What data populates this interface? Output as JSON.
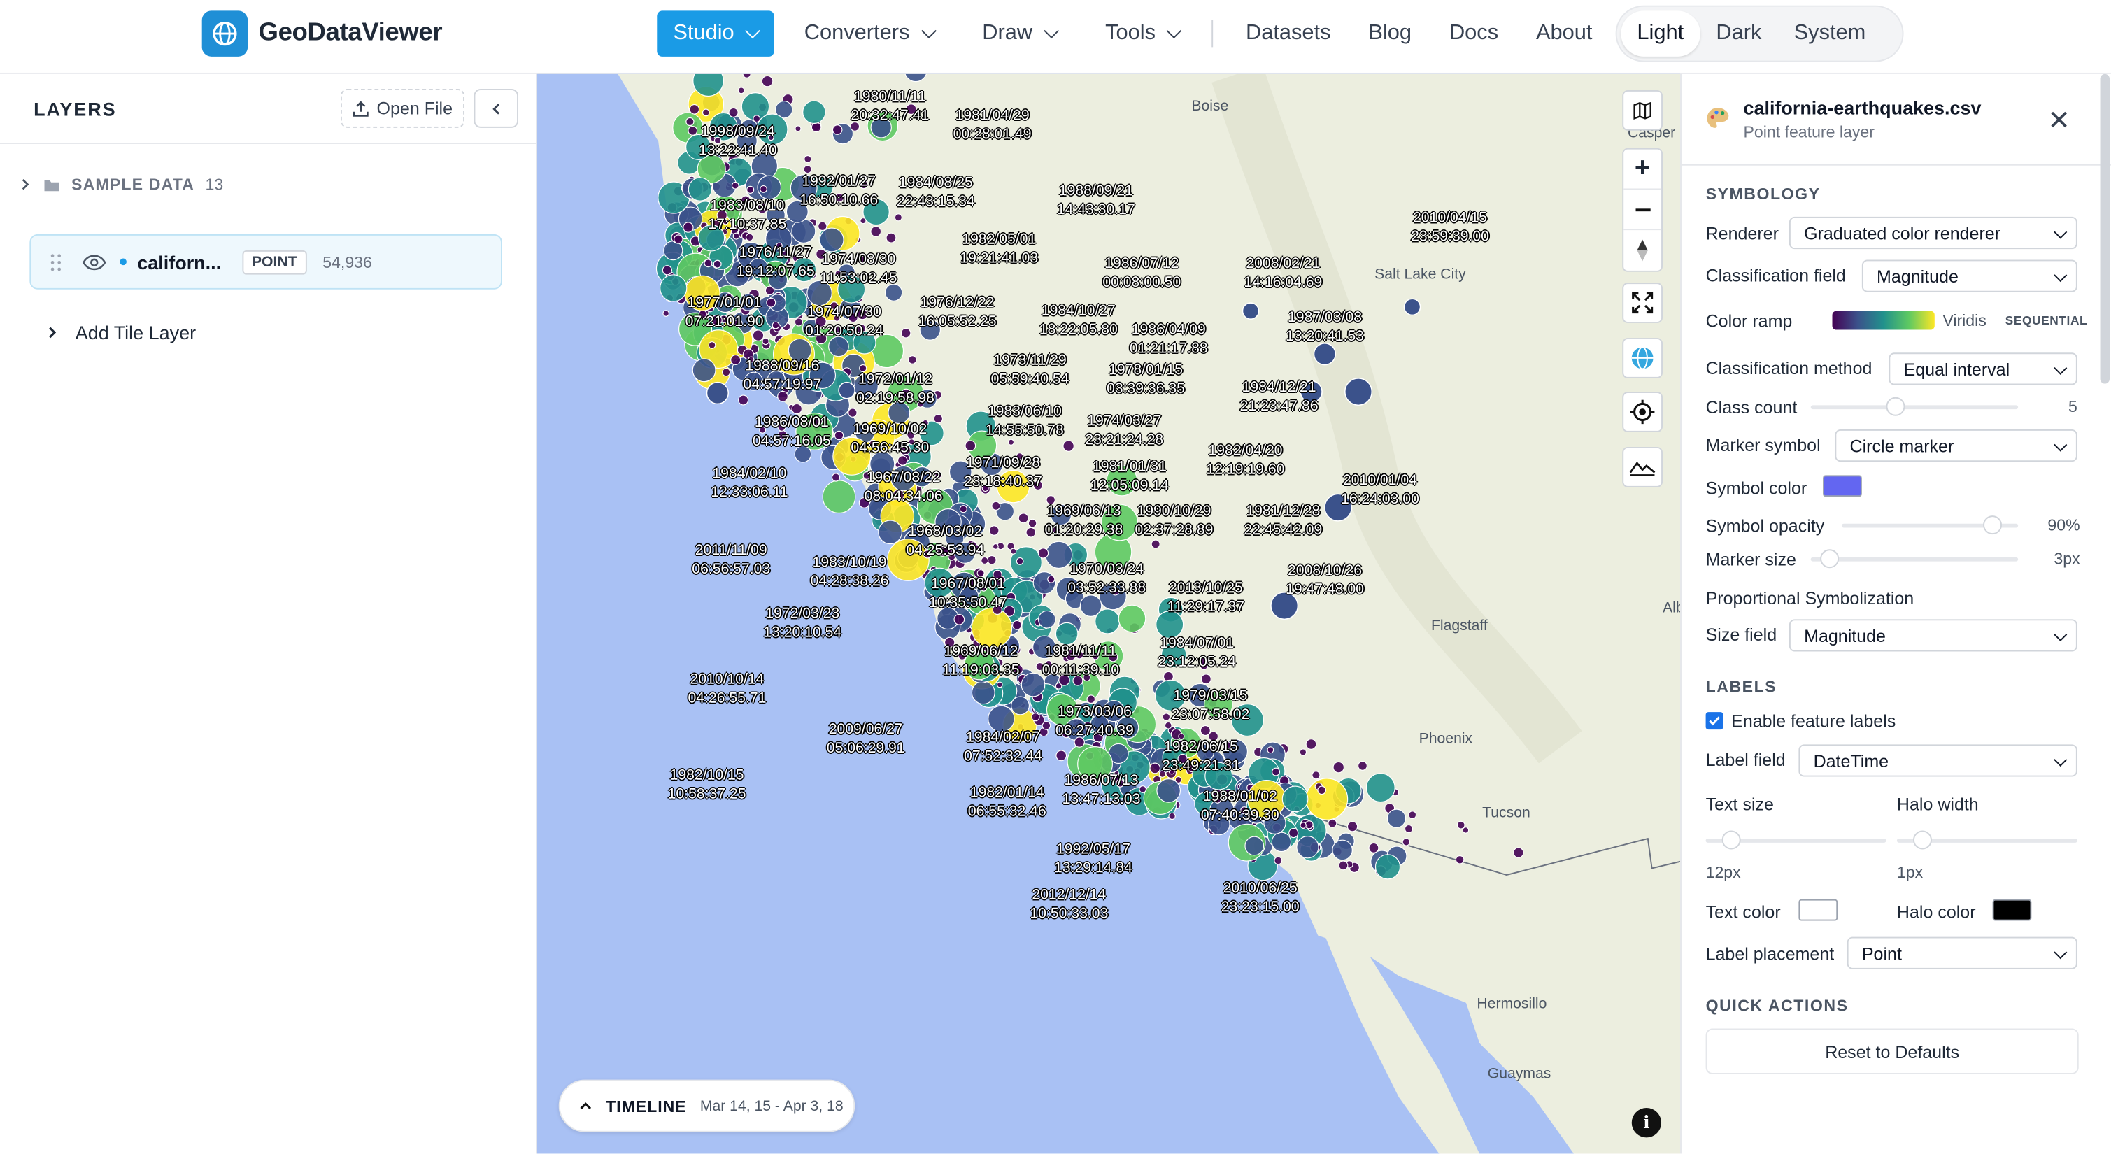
{
  "app": {
    "name": "GeoDataViewer"
  },
  "nav": {
    "items": [
      {
        "label": "Studio",
        "has_dropdown": true,
        "active": true
      },
      {
        "label": "Converters",
        "has_dropdown": true
      },
      {
        "label": "Draw",
        "has_dropdown": true
      },
      {
        "label": "Tools",
        "has_dropdown": true
      },
      {
        "label": "Datasets"
      },
      {
        "label": "Blog"
      },
      {
        "label": "Docs"
      },
      {
        "label": "About"
      }
    ],
    "theme_options": [
      "Light",
      "Dark",
      "System"
    ],
    "theme_selected": "Light"
  },
  "layers_panel": {
    "title": "LAYERS",
    "open_file_label": "Open File",
    "group": {
      "title": "SAMPLE DATA",
      "count": "13"
    },
    "layer": {
      "name": "californ...",
      "type_badge": "POINT",
      "feature_count": "54,936"
    },
    "add_tile_label": "Add Tile Layer"
  },
  "map": {
    "place_labels": [
      "Boise",
      "Casper",
      "Salt Lake City",
      "Flagstaff",
      "Phoenix",
      "Tucson",
      "Hermosillo",
      "Guaymas",
      "Alb"
    ],
    "feature_labels": [
      {
        "date": "1980/11/11",
        "time": "20:32:47.41"
      },
      {
        "date": "1981/04/29",
        "time": "00:28:01.49"
      },
      {
        "date": "1998/09/24",
        "time": "13:22:41.40"
      },
      {
        "date": "1992/01/27",
        "time": "16:50:10.66"
      },
      {
        "date": "1984/08/25",
        "time": "22:43:15.34"
      },
      {
        "date": "1988/09/21",
        "time": "14:43:30.17"
      },
      {
        "date": "1983/08/10",
        "time": "17:10:37.85"
      },
      {
        "date": "1982/05/01",
        "time": "19:21:41.03"
      },
      {
        "date": "1976/11/27",
        "time": "19:12:07.65"
      },
      {
        "date": "1974/08/30",
        "time": "11:53:02.45"
      },
      {
        "date": "1986/07/12",
        "time": "00:08:00.50"
      },
      {
        "date": "2008/02/21",
        "time": "14:16:04.69"
      },
      {
        "date": "2010/04/15",
        "time": "23:59:39.00"
      },
      {
        "date": "1977/01/01",
        "time": "07:21:01.90"
      },
      {
        "date": "1974/07/30",
        "time": "01:20:50.24"
      },
      {
        "date": "1976/12/22",
        "time": "16:05:52.25"
      },
      {
        "date": "1984/10/27",
        "time": "18:22:05.80"
      },
      {
        "date": "1986/04/09",
        "time": "01:21:17.88"
      },
      {
        "date": "1987/03/08",
        "time": "13:20:41.53"
      },
      {
        "date": "1988/09/16",
        "time": "04:57:19.97"
      },
      {
        "date": "1972/01/12",
        "time": "02:19:58.98"
      },
      {
        "date": "1973/11/29",
        "time": "05:59:40.54"
      },
      {
        "date": "1978/01/15",
        "time": "03:39:36.35"
      },
      {
        "date": "1984/12/21",
        "time": "21:23:47.86"
      },
      {
        "date": "1986/08/01",
        "time": "04:57:16.05"
      },
      {
        "date": "1969/10/02",
        "time": "04:56:45.30"
      },
      {
        "date": "1983/06/10",
        "time": "14:55:50.78"
      },
      {
        "date": "1974/03/27",
        "time": "23:21:24.28"
      },
      {
        "date": "1984/02/10",
        "time": "12:33:06.11"
      },
      {
        "date": "1967/08/22",
        "time": "08:04:34.06"
      },
      {
        "date": "1971/09/28",
        "time": "23:18:40.37"
      },
      {
        "date": "1981/01/31",
        "time": "12:05:09.14"
      },
      {
        "date": "1982/04/20",
        "time": "12:19:19.60"
      },
      {
        "date": "2010/01/04",
        "time": "16:24:03.00"
      },
      {
        "date": "1968/03/02",
        "time": "04:25:53.94"
      },
      {
        "date": "1969/06/13",
        "time": "01:20:29.38"
      },
      {
        "date": "1990/10/29",
        "time": "02:37:28.89"
      },
      {
        "date": "1981/12/28",
        "time": "22:45:42.09"
      },
      {
        "date": "2011/11/09",
        "time": "06:56:57.03"
      },
      {
        "date": "1983/10/19",
        "time": "04:28:38.26"
      },
      {
        "date": "1967/08/01",
        "time": "10:35:50.47"
      },
      {
        "date": "1970/03/24",
        "time": "03:52:33.88"
      },
      {
        "date": "2013/10/25",
        "time": "11:29:17.37"
      },
      {
        "date": "2008/10/26",
        "time": "19:47:48.00"
      },
      {
        "date": "1972/03/23",
        "time": "13:20:10.54"
      },
      {
        "date": "1984/07/01",
        "time": "23:12:05.24"
      },
      {
        "date": "1969/06/12",
        "time": "11:19:03.35"
      },
      {
        "date": "1981/11/11",
        "time": "00:11:39.10"
      },
      {
        "date": "2010/10/14",
        "time": "04:26:55.71"
      },
      {
        "date": "1979/03/15",
        "time": "23:07:58.02"
      },
      {
        "date": "1973/03/06",
        "time": "06:27:40.39"
      },
      {
        "date": "2009/06/27",
        "time": "05:06:29.91"
      },
      {
        "date": "1984/02/07",
        "time": "07:52:32.44"
      },
      {
        "date": "1982/06/15",
        "time": "23:49:21.31"
      },
      {
        "date": "1982/10/15",
        "time": "10:58:37.25"
      },
      {
        "date": "1986/07/13",
        "time": "13:47:13.03"
      },
      {
        "date": "1982/01/14",
        "time": "06:55:32.46"
      },
      {
        "date": "1988/01/02",
        "time": "07:40:39.30"
      },
      {
        "date": "1992/05/17",
        "time": "13:29:14.84"
      },
      {
        "date": "2010/06/25",
        "time": "23:23:15.00"
      },
      {
        "date": "2012/12/14",
        "time": "10:50:33.03"
      }
    ],
    "timeline": {
      "label": "TIMELINE",
      "range": "Mar 14, 15 - Apr 3, 18"
    }
  },
  "properties_panel": {
    "layer_title": "california-earthquakes.csv",
    "layer_subtitle": "Point feature layer",
    "symbology_title": "SYMBOLOGY",
    "renderer_label": "Renderer",
    "renderer_value": "Graduated color renderer",
    "class_field_label": "Classification field",
    "class_field_value": "Magnitude",
    "color_ramp_label": "Color ramp",
    "color_ramp_name": "Viridis",
    "color_ramp_type": "SEQUENTIAL",
    "class_method_label": "Classification method",
    "class_method_value": "Equal interval",
    "class_count_label": "Class count",
    "class_count_value": "5",
    "class_count_fraction": 0.4,
    "marker_symbol_label": "Marker symbol",
    "marker_symbol_value": "Circle marker",
    "symbol_color_label": "Symbol color",
    "symbol_color": "#6366f1",
    "symbol_opacity_label": "Symbol opacity",
    "symbol_opacity_value": "90%",
    "symbol_opacity_fraction": 0.9,
    "marker_size_label": "Marker size",
    "marker_size_value": "3px",
    "marker_size_fraction": 0.05,
    "prop_symbol_title": "Proportional Symbolization",
    "size_field_label": "Size field",
    "size_field_value": "Magnitude",
    "labels_title": "LABELS",
    "enable_labels_label": "Enable feature labels",
    "enable_labels_checked": true,
    "label_field_label": "Label field",
    "label_field_value": "DateTime",
    "text_size_label": "Text size",
    "text_size_value": "12px",
    "text_size_fraction": 0.1,
    "halo_width_label": "Halo width",
    "halo_width_value": "1px",
    "halo_width_fraction": 0.1,
    "text_color_label": "Text color",
    "text_color": "#ffffff",
    "halo_color_label": "Halo color",
    "halo_color": "#000000",
    "label_placement_label": "Label placement",
    "label_placement_value": "Point",
    "quick_actions_title": "QUICK ACTIONS",
    "reset_label": "Reset to Defaults"
  },
  "colors": {
    "accent": "#1a9be6",
    "water": "#a9c1f4",
    "land": "#e9eddc",
    "viridis": [
      "#440154",
      "#3b528b",
      "#21918c",
      "#5ec962",
      "#fde725"
    ]
  }
}
